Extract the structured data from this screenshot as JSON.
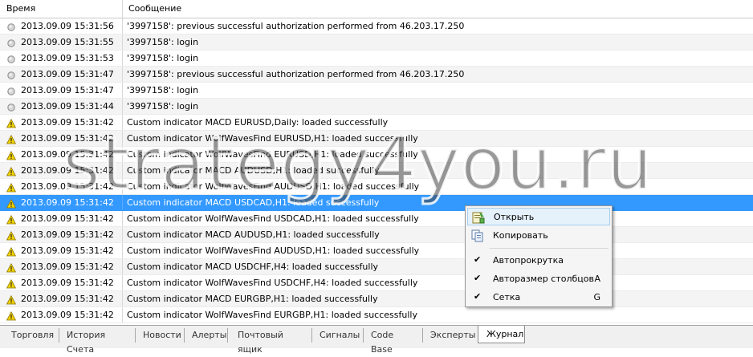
{
  "header": {
    "time_label": "Время",
    "message_label": "Сообщение"
  },
  "rows": [
    {
      "icon": "info-circle-icon",
      "time": "2013.09.09 15:31:56",
      "message": "'3997158': previous successful authorization performed from 46.203.17.250"
    },
    {
      "icon": "info-circle-icon",
      "time": "2013.09.09 15:31:55",
      "message": "'3997158': login"
    },
    {
      "icon": "info-circle-icon",
      "time": "2013.09.09 15:31:53",
      "message": "'3997158': login"
    },
    {
      "icon": "info-circle-icon",
      "time": "2013.09.09 15:31:47",
      "message": "'3997158': previous successful authorization performed from 46.203.17.250"
    },
    {
      "icon": "info-circle-icon",
      "time": "2013.09.09 15:31:47",
      "message": "'3997158': login"
    },
    {
      "icon": "info-circle-icon",
      "time": "2013.09.09 15:31:44",
      "message": "'3997158': login"
    },
    {
      "icon": "warning-icon",
      "time": "2013.09.09 15:31:42",
      "message": "Custom indicator MACD EURUSD,Daily: loaded successfully"
    },
    {
      "icon": "warning-icon",
      "time": "2013.09.09 15:31:42",
      "message": "Custom indicator WolfWavesFind EURUSD,H1: loaded successfully"
    },
    {
      "icon": "warning-icon",
      "time": "2013.09.09 15:31:42",
      "message": "Custom indicator WolfWavesFind EURUSD,H1: loaded successfully"
    },
    {
      "icon": "warning-icon",
      "time": "2013.09.09 15:31:42",
      "message": "Custom indicator MACD AUDUSD,H1: loaded successfully"
    },
    {
      "icon": "warning-icon",
      "time": "2013.09.09 15:31:42",
      "message": "Custom indicator WolfWavesFind AUDUSD,H1: loaded successfully"
    },
    {
      "icon": "warning-icon",
      "time": "2013.09.09 15:31:42",
      "message": "Custom indicator MACD USDCAD,H1: loaded successfully",
      "selected": true
    },
    {
      "icon": "warning-icon",
      "time": "2013.09.09 15:31:42",
      "message": "Custom indicator WolfWavesFind USDCAD,H1: loaded successfully"
    },
    {
      "icon": "warning-icon",
      "time": "2013.09.09 15:31:42",
      "message": "Custom indicator MACD AUDUSD,H1: loaded successfully"
    },
    {
      "icon": "warning-icon",
      "time": "2013.09.09 15:31:42",
      "message": "Custom indicator WolfWavesFind AUDUSD,H1: loaded successfully"
    },
    {
      "icon": "warning-icon",
      "time": "2013.09.09 15:31:42",
      "message": "Custom indicator MACD USDCHF,H4: loaded successfully"
    },
    {
      "icon": "warning-icon",
      "time": "2013.09.09 15:31:42",
      "message": "Custom indicator WolfWavesFind USDCHF,H4: loaded successfully"
    },
    {
      "icon": "warning-icon",
      "time": "2013.09.09 15:31:42",
      "message": "Custom indicator MACD EURGBP,H1: loaded successfully"
    },
    {
      "icon": "warning-icon",
      "time": "2013.09.09 15:31:42",
      "message": "Custom indicator WolfWavesFind EURGBP,H1: loaded successfully"
    }
  ],
  "watermark": "strategy4you.ru",
  "context_menu": {
    "open": {
      "label": "Открыть"
    },
    "copy": {
      "label": "Копировать"
    },
    "autoscroll": {
      "label": "Автопрокрутка",
      "checked": true
    },
    "autosize": {
      "label": "Авторазмер столбцов",
      "shortcut": "A",
      "checked": true
    },
    "grid": {
      "label": "Сетка",
      "shortcut": "G",
      "checked": true
    }
  },
  "tabs": [
    {
      "label": "Торговля"
    },
    {
      "label": "История Счета"
    },
    {
      "label": "Новости"
    },
    {
      "label": "Алерты"
    },
    {
      "label": "Почтовый ящик"
    },
    {
      "label": "Сигналы"
    },
    {
      "label": "Code Base"
    },
    {
      "label": "Эксперты"
    },
    {
      "label": "Журнал",
      "active": true
    }
  ],
  "colors": {
    "selection": "#3399ff",
    "row_alt": "#f4f4f4",
    "warning": "#f2d200",
    "info": "#9a9a9a"
  }
}
